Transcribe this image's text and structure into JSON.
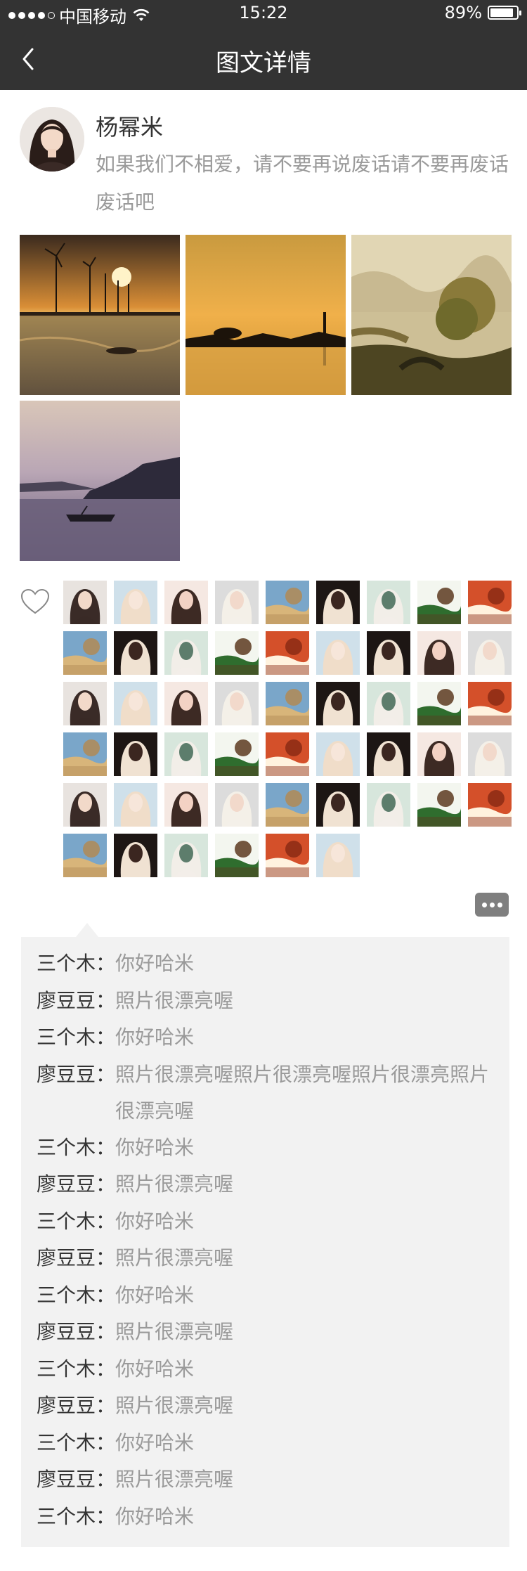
{
  "status_bar": {
    "carrier": "中国移动",
    "time": "15:22",
    "battery": "89%",
    "battery_level": 0.89
  },
  "nav": {
    "title": "图文详情"
  },
  "post": {
    "author": "杨幂米",
    "text": "如果我们不相爱，请不要再说废话请不要再废话废话吧"
  },
  "comments": [
    {
      "name": "三个木：",
      "text": "你好哈米"
    },
    {
      "name": "廖豆豆：",
      "text": "照片很漂亮喔"
    },
    {
      "name": "三个木：",
      "text": "你好哈米"
    },
    {
      "name": "廖豆豆：",
      "text": "照片很漂亮喔照片很漂亮喔照片很漂亮照片很漂亮喔"
    },
    {
      "name": "三个木：",
      "text": "你好哈米"
    },
    {
      "name": "廖豆豆：",
      "text": "照片很漂亮喔"
    },
    {
      "name": "三个木：",
      "text": "你好哈米"
    },
    {
      "name": "廖豆豆：",
      "text": "照片很漂亮喔"
    },
    {
      "name": "三个木：",
      "text": "你好哈米"
    },
    {
      "name": "廖豆豆：",
      "text": "照片很漂亮喔"
    },
    {
      "name": "三个木：",
      "text": "你好哈米"
    },
    {
      "name": "廖豆豆：",
      "text": "照片很漂亮喔"
    },
    {
      "name": "三个木：",
      "text": "你好哈米"
    },
    {
      "name": "廖豆豆：",
      "text": "照片很漂亮喔"
    },
    {
      "name": "三个木：",
      "text": "你好哈米"
    }
  ],
  "icons": {
    "back": "chevron-left-icon",
    "like": "heart-icon",
    "more": "more-dots-icon"
  }
}
